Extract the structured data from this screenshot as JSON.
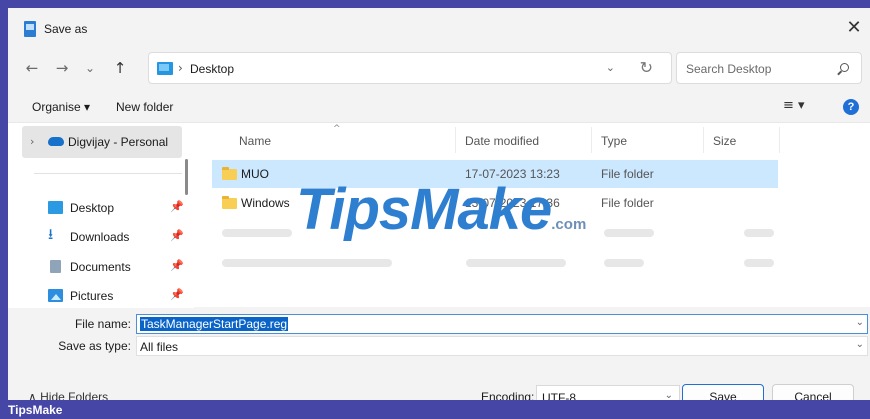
{
  "window": {
    "title": "Save as",
    "close_glyph": "✕"
  },
  "nav": {
    "back_glyph": "←",
    "forward_glyph": "→",
    "recent_glyph": "⌄",
    "up_glyph": "↑",
    "address_sep": "›",
    "address_text": "Desktop",
    "address_dropdown_glyph": "⌄",
    "refresh_glyph": "↻",
    "search_placeholder": "Search Desktop"
  },
  "commands": {
    "organise": "Organise ▾",
    "new_folder": "New folder",
    "view_glyph": "≡ ▾",
    "help_glyph": "?"
  },
  "sidebar": {
    "onedrive": {
      "chevron": "›",
      "label": "Digvijay - Personal",
      "icon": "cloud-icon"
    },
    "items": [
      {
        "label": "Desktop",
        "icon": "desktop-icon",
        "pin": "📌"
      },
      {
        "label": "Downloads",
        "icon": "download-icon",
        "glyph": "⭳",
        "pin": "📌"
      },
      {
        "label": "Documents",
        "icon": "documents-icon",
        "pin": "📌"
      },
      {
        "label": "Pictures",
        "icon": "pictures-icon",
        "pin": "📌"
      }
    ]
  },
  "filelist": {
    "sort_glyph": "^",
    "columns": [
      "Name",
      "Date modified",
      "Type",
      "Size"
    ],
    "rows": [
      {
        "name": "MUO",
        "date": "17-07-2023 13:23",
        "type": "File folder",
        "selected": true
      },
      {
        "name": "Windows",
        "date": "13-07-2023 17:36",
        "type": "File folder",
        "selected": false
      }
    ]
  },
  "form": {
    "filename_label": "File name:",
    "filename_value": "TaskManagerStartPage.reg",
    "savetype_label": "Save as type:",
    "savetype_value": "All files",
    "caret_glyph": "⌄"
  },
  "footer": {
    "hide_folders": "∧  Hide Folders",
    "encoding_label": "Encoding:",
    "encoding_value": "UTF-8",
    "encoding_caret": "⌄",
    "save_label": "Save",
    "cancel_label": "Cancel"
  },
  "watermark": {
    "main": "TipsMake",
    "suffix": ".com"
  },
  "brand": "TipsMake",
  "colors": {
    "accent": "#1f6fd6",
    "selection": "#cce8ff",
    "frame": "#4646a6"
  }
}
